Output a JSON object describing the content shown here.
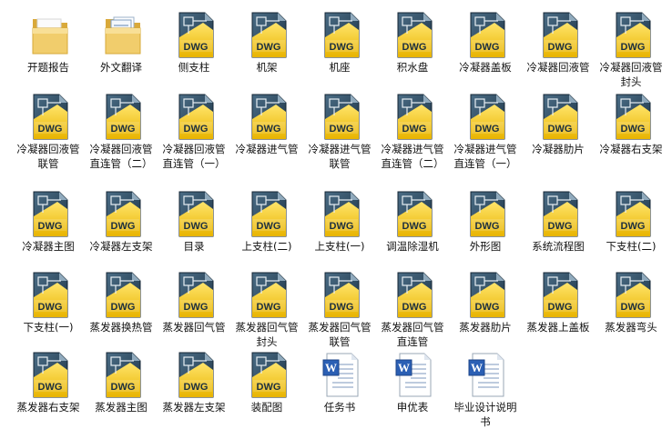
{
  "files": [
    {
      "name": "开题报告",
      "icon": "folder-icon"
    },
    {
      "name": "外文翻译",
      "icon": "folder-with-documents-icon"
    },
    {
      "name": "侧支柱",
      "icon": "dwg-file-icon"
    },
    {
      "name": "机架",
      "icon": "dwg-file-icon"
    },
    {
      "name": "机座",
      "icon": "dwg-file-icon"
    },
    {
      "name": "积水盘",
      "icon": "dwg-file-icon"
    },
    {
      "name": "冷凝器盖板",
      "icon": "dwg-file-icon"
    },
    {
      "name": "冷凝器回液管",
      "icon": "dwg-file-icon"
    },
    {
      "name": "冷凝器回液管封头",
      "icon": "dwg-file-icon"
    },
    {
      "name": "冷凝器回液管联管",
      "icon": "dwg-file-icon"
    },
    {
      "name": "冷凝器回液管直连管（二）",
      "icon": "dwg-file-icon"
    },
    {
      "name": "冷凝器回液管直连管（一）",
      "icon": "dwg-file-icon"
    },
    {
      "name": "冷凝器进气管",
      "icon": "dwg-file-icon"
    },
    {
      "name": "冷凝器进气管联管",
      "icon": "dwg-file-icon"
    },
    {
      "name": "冷凝器进气管直连管（二）",
      "icon": "dwg-file-icon"
    },
    {
      "name": "冷凝器进气管直连管（一）",
      "icon": "dwg-file-icon"
    },
    {
      "name": "冷凝器肋片",
      "icon": "dwg-file-icon"
    },
    {
      "name": "冷凝器右支架",
      "icon": "dwg-file-icon"
    },
    {
      "name": "冷凝器主图",
      "icon": "dwg-file-icon"
    },
    {
      "name": "冷凝器左支架",
      "icon": "dwg-file-icon"
    },
    {
      "name": "目录",
      "icon": "dwg-file-icon"
    },
    {
      "name": "上支柱(二)",
      "icon": "dwg-file-icon"
    },
    {
      "name": "上支柱(一)",
      "icon": "dwg-file-icon"
    },
    {
      "name": "调温除湿机",
      "icon": "dwg-file-icon"
    },
    {
      "name": "外形图",
      "icon": "dwg-file-icon"
    },
    {
      "name": "系统流程图",
      "icon": "dwg-file-icon"
    },
    {
      "name": "下支柱(二)",
      "icon": "dwg-file-icon"
    },
    {
      "name": "下支柱(一)",
      "icon": "dwg-file-icon"
    },
    {
      "name": "蒸发器换热管",
      "icon": "dwg-file-icon"
    },
    {
      "name": "蒸发器回气管",
      "icon": "dwg-file-icon"
    },
    {
      "name": "蒸发器回气管封头",
      "icon": "dwg-file-icon"
    },
    {
      "name": "蒸发器回气管联管",
      "icon": "dwg-file-icon"
    },
    {
      "name": "蒸发器回气管直连管",
      "icon": "dwg-file-icon"
    },
    {
      "name": "蒸发器肋片",
      "icon": "dwg-file-icon"
    },
    {
      "name": "蒸发器上盖板",
      "icon": "dwg-file-icon"
    },
    {
      "name": "蒸发器弯头",
      "icon": "dwg-file-icon"
    },
    {
      "name": "蒸发器右支架",
      "icon": "dwg-file-icon"
    },
    {
      "name": "蒸发器主图",
      "icon": "dwg-file-icon"
    },
    {
      "name": "蒸发器左支架",
      "icon": "dwg-file-icon"
    },
    {
      "name": "装配图",
      "icon": "dwg-file-icon"
    },
    {
      "name": "任务书",
      "icon": "word-document-icon"
    },
    {
      "name": "申优表",
      "icon": "word-document-icon"
    },
    {
      "name": "毕业设计说明书",
      "icon": "word-document-icon"
    }
  ],
  "dwg_badge": "DWG",
  "colors": {
    "dwg_dark": "#1f3a4e",
    "dwg_yellow": "#f2c200",
    "folder_yellow": "#f3d37a",
    "word_blue": "#2b5fb4"
  }
}
